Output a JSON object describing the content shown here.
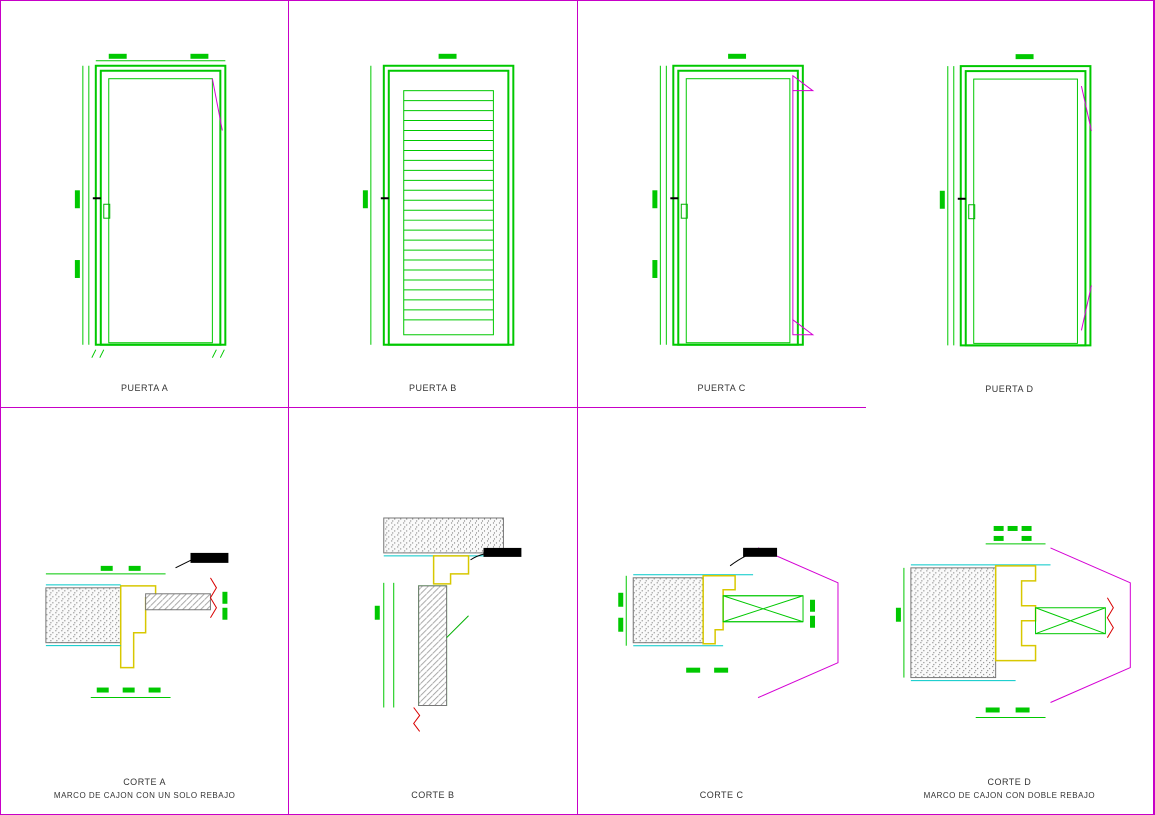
{
  "cells": {
    "c0": {
      "title": "PUERTA A",
      "sub": ""
    },
    "c1": {
      "title": "PUERTA B",
      "sub": ""
    },
    "c2": {
      "title": "PUERTA C",
      "sub": ""
    },
    "c3": {
      "title": "PUERTA D",
      "sub": ""
    },
    "c4": {
      "title": "CORTE A",
      "sub": "MARCO DE CAJON CON UN SOLO REBAJO"
    },
    "c5": {
      "title": "CORTE B",
      "sub": ""
    },
    "c6": {
      "title": "CORTE C",
      "sub": ""
    },
    "c7": {
      "title": "CORTE D",
      "sub": "MARCO DE CAJON CON DOBLE REBAJO"
    }
  }
}
